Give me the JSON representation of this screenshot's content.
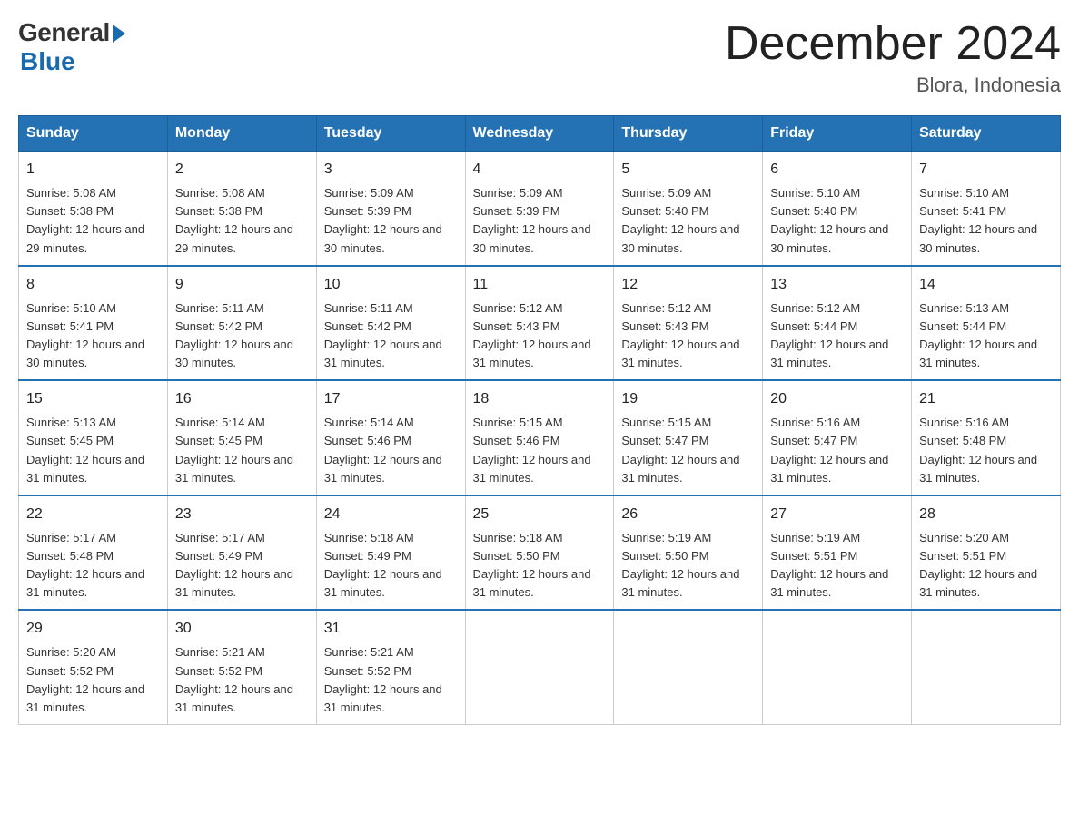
{
  "logo": {
    "general": "General",
    "blue": "Blue"
  },
  "title": {
    "month_year": "December 2024",
    "location": "Blora, Indonesia"
  },
  "days_header": [
    "Sunday",
    "Monday",
    "Tuesday",
    "Wednesday",
    "Thursday",
    "Friday",
    "Saturday"
  ],
  "weeks": [
    [
      {
        "day": "1",
        "sunrise": "5:08 AM",
        "sunset": "5:38 PM",
        "daylight": "12 hours and 29 minutes."
      },
      {
        "day": "2",
        "sunrise": "5:08 AM",
        "sunset": "5:38 PM",
        "daylight": "12 hours and 29 minutes."
      },
      {
        "day": "3",
        "sunrise": "5:09 AM",
        "sunset": "5:39 PM",
        "daylight": "12 hours and 30 minutes."
      },
      {
        "day": "4",
        "sunrise": "5:09 AM",
        "sunset": "5:39 PM",
        "daylight": "12 hours and 30 minutes."
      },
      {
        "day": "5",
        "sunrise": "5:09 AM",
        "sunset": "5:40 PM",
        "daylight": "12 hours and 30 minutes."
      },
      {
        "day": "6",
        "sunrise": "5:10 AM",
        "sunset": "5:40 PM",
        "daylight": "12 hours and 30 minutes."
      },
      {
        "day": "7",
        "sunrise": "5:10 AM",
        "sunset": "5:41 PM",
        "daylight": "12 hours and 30 minutes."
      }
    ],
    [
      {
        "day": "8",
        "sunrise": "5:10 AM",
        "sunset": "5:41 PM",
        "daylight": "12 hours and 30 minutes."
      },
      {
        "day": "9",
        "sunrise": "5:11 AM",
        "sunset": "5:42 PM",
        "daylight": "12 hours and 30 minutes."
      },
      {
        "day": "10",
        "sunrise": "5:11 AM",
        "sunset": "5:42 PM",
        "daylight": "12 hours and 31 minutes."
      },
      {
        "day": "11",
        "sunrise": "5:12 AM",
        "sunset": "5:43 PM",
        "daylight": "12 hours and 31 minutes."
      },
      {
        "day": "12",
        "sunrise": "5:12 AM",
        "sunset": "5:43 PM",
        "daylight": "12 hours and 31 minutes."
      },
      {
        "day": "13",
        "sunrise": "5:12 AM",
        "sunset": "5:44 PM",
        "daylight": "12 hours and 31 minutes."
      },
      {
        "day": "14",
        "sunrise": "5:13 AM",
        "sunset": "5:44 PM",
        "daylight": "12 hours and 31 minutes."
      }
    ],
    [
      {
        "day": "15",
        "sunrise": "5:13 AM",
        "sunset": "5:45 PM",
        "daylight": "12 hours and 31 minutes."
      },
      {
        "day": "16",
        "sunrise": "5:14 AM",
        "sunset": "5:45 PM",
        "daylight": "12 hours and 31 minutes."
      },
      {
        "day": "17",
        "sunrise": "5:14 AM",
        "sunset": "5:46 PM",
        "daylight": "12 hours and 31 minutes."
      },
      {
        "day": "18",
        "sunrise": "5:15 AM",
        "sunset": "5:46 PM",
        "daylight": "12 hours and 31 minutes."
      },
      {
        "day": "19",
        "sunrise": "5:15 AM",
        "sunset": "5:47 PM",
        "daylight": "12 hours and 31 minutes."
      },
      {
        "day": "20",
        "sunrise": "5:16 AM",
        "sunset": "5:47 PM",
        "daylight": "12 hours and 31 minutes."
      },
      {
        "day": "21",
        "sunrise": "5:16 AM",
        "sunset": "5:48 PM",
        "daylight": "12 hours and 31 minutes."
      }
    ],
    [
      {
        "day": "22",
        "sunrise": "5:17 AM",
        "sunset": "5:48 PM",
        "daylight": "12 hours and 31 minutes."
      },
      {
        "day": "23",
        "sunrise": "5:17 AM",
        "sunset": "5:49 PM",
        "daylight": "12 hours and 31 minutes."
      },
      {
        "day": "24",
        "sunrise": "5:18 AM",
        "sunset": "5:49 PM",
        "daylight": "12 hours and 31 minutes."
      },
      {
        "day": "25",
        "sunrise": "5:18 AM",
        "sunset": "5:50 PM",
        "daylight": "12 hours and 31 minutes."
      },
      {
        "day": "26",
        "sunrise": "5:19 AM",
        "sunset": "5:50 PM",
        "daylight": "12 hours and 31 minutes."
      },
      {
        "day": "27",
        "sunrise": "5:19 AM",
        "sunset": "5:51 PM",
        "daylight": "12 hours and 31 minutes."
      },
      {
        "day": "28",
        "sunrise": "5:20 AM",
        "sunset": "5:51 PM",
        "daylight": "12 hours and 31 minutes."
      }
    ],
    [
      {
        "day": "29",
        "sunrise": "5:20 AM",
        "sunset": "5:52 PM",
        "daylight": "12 hours and 31 minutes."
      },
      {
        "day": "30",
        "sunrise": "5:21 AM",
        "sunset": "5:52 PM",
        "daylight": "12 hours and 31 minutes."
      },
      {
        "day": "31",
        "sunrise": "5:21 AM",
        "sunset": "5:52 PM",
        "daylight": "12 hours and 31 minutes."
      },
      null,
      null,
      null,
      null
    ]
  ]
}
